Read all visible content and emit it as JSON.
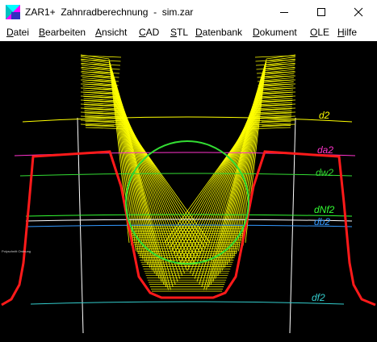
{
  "window": {
    "title": "ZAR1+  Zahnradberechnung  -  sim.zar",
    "icon": "zar-app-icon",
    "controls": [
      "minimize-icon",
      "maximize-icon",
      "close-icon"
    ]
  },
  "menu": [
    {
      "u": "D",
      "rest": "atei"
    },
    {
      "u": "B",
      "rest": "earbeiten"
    },
    {
      "u": "A",
      "rest": "nsicht"
    },
    {
      "u": "C",
      "rest": "AD"
    },
    {
      "u": "S",
      "rest": "TL"
    },
    {
      "u": "D",
      "rest": "atenbank"
    },
    {
      "u": "D",
      "rest": "okument"
    },
    {
      "u": "O",
      "rest": "LE"
    },
    {
      "u": "H",
      "rest": "ilfe"
    }
  ],
  "drawing": {
    "small_label": "Polyschnitt Ordnung",
    "circles": [
      {
        "label": "d2",
        "color": "#ffff00"
      },
      {
        "label": "da2",
        "color": "#ff33cc"
      },
      {
        "label": "dw2",
        "color": "#33dd33"
      },
      {
        "label": "dNf2",
        "color": "#33ff33"
      },
      {
        "label": "db2",
        "color": "#3399ff"
      },
      {
        "label": "df2",
        "color": "#33cccc"
      }
    ],
    "colors": {
      "background": "#000000",
      "envelope": "#ffff00",
      "gear_profile": "#ff1a1a",
      "circle": "#33dd33",
      "white_line": "#ffffff"
    }
  }
}
